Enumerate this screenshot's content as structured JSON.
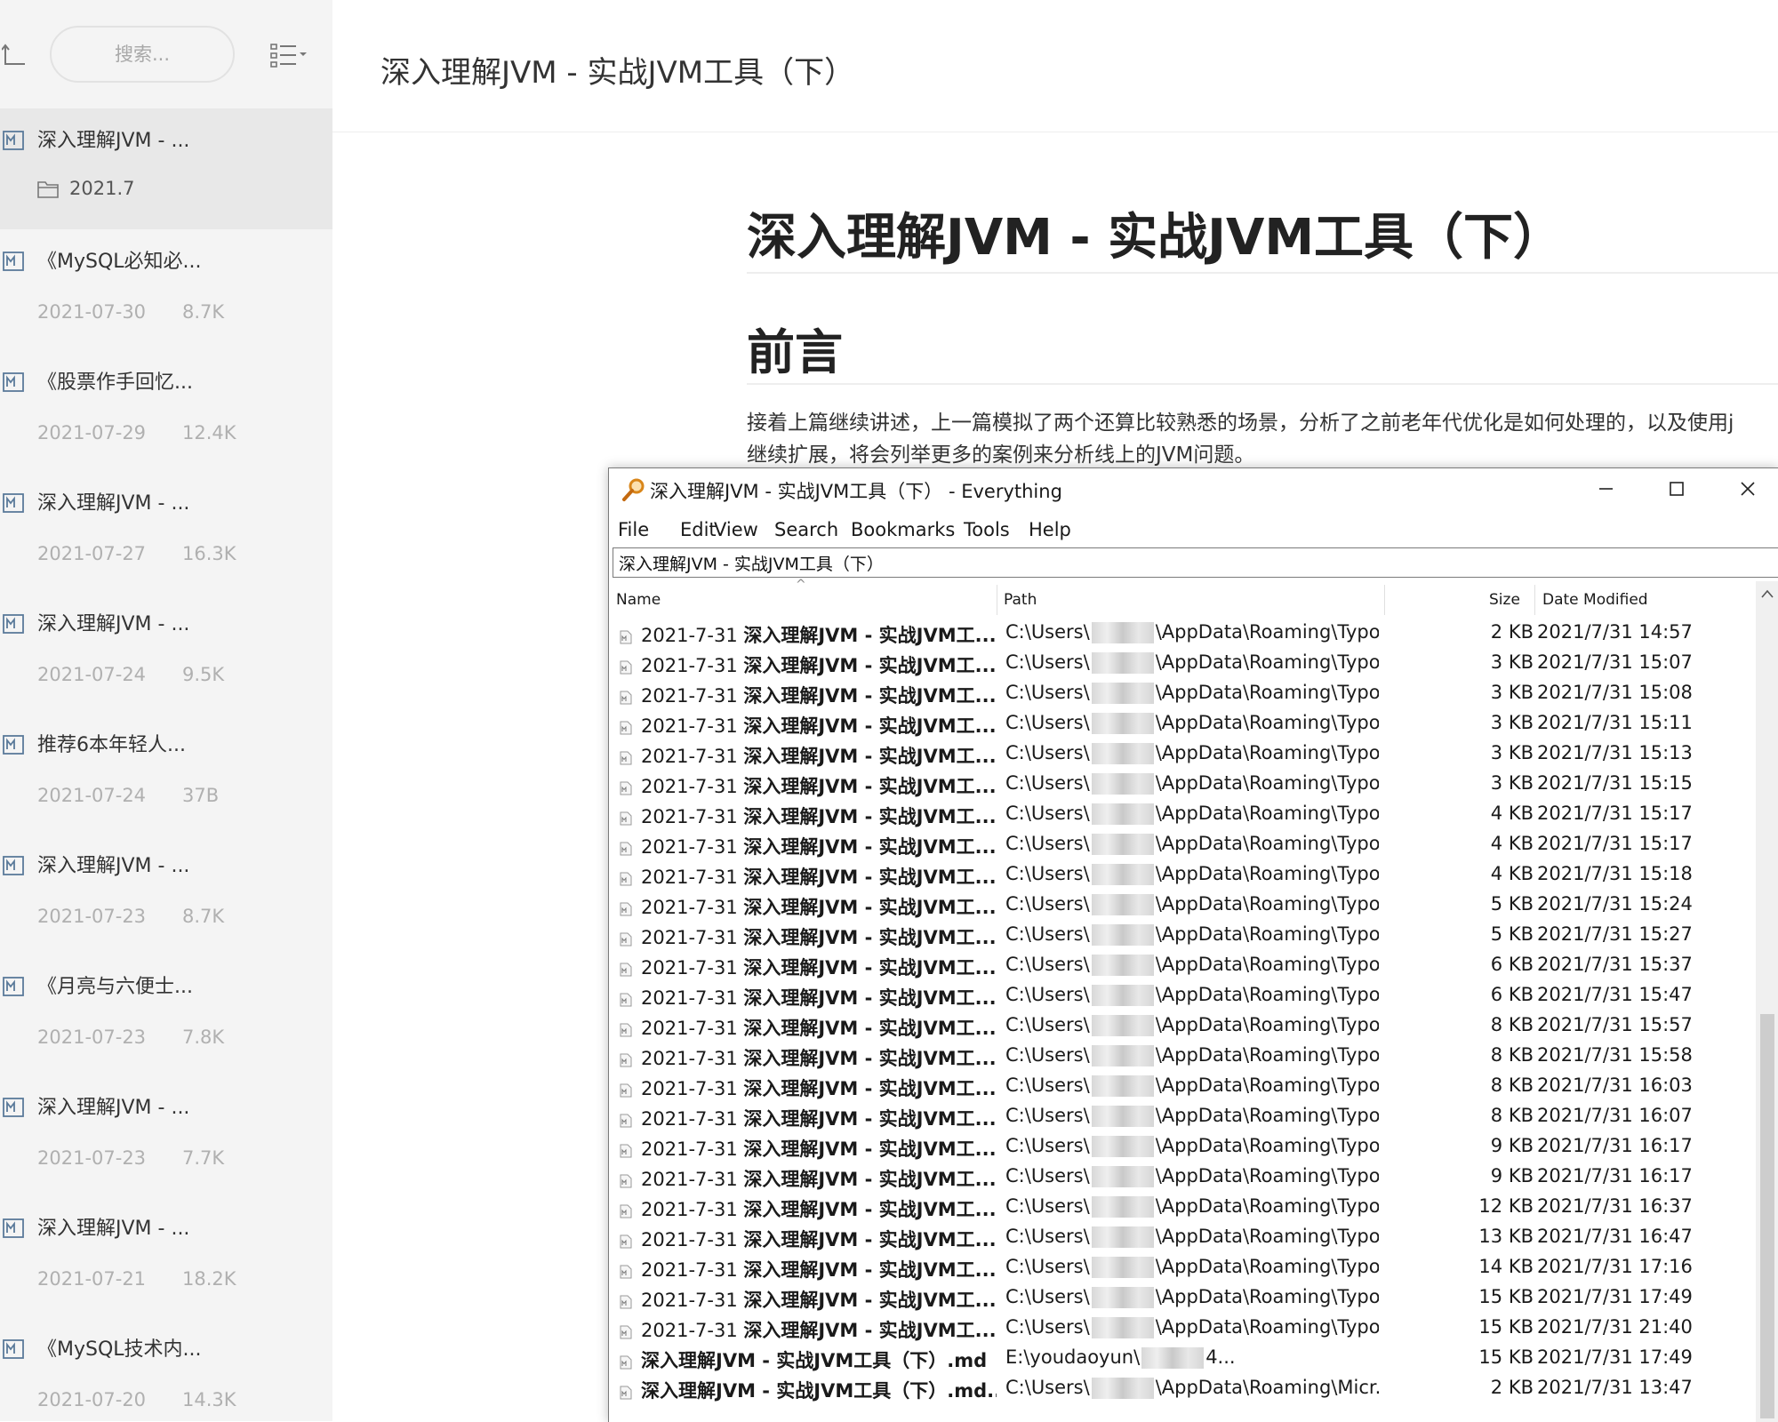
{
  "sidebar": {
    "search_placeholder": "搜索...",
    "files": [
      {
        "title": "深入理解JVM - ...",
        "folder": "2021.7",
        "active": true
      },
      {
        "title": "《MySQL必知必...",
        "date": "2021-07-30",
        "size": "8.7K"
      },
      {
        "title": "《股票作手回忆...",
        "date": "2021-07-29",
        "size": "12.4K"
      },
      {
        "title": "深入理解JVM - ...",
        "date": "2021-07-27",
        "size": "16.3K"
      },
      {
        "title": "深入理解JVM - ...",
        "date": "2021-07-24",
        "size": "9.5K"
      },
      {
        "title": "推荐6本年轻人...",
        "date": "2021-07-24",
        "size": "37B"
      },
      {
        "title": "深入理解JVM - ...",
        "date": "2021-07-23",
        "size": "8.7K"
      },
      {
        "title": "《月亮与六便士...",
        "date": "2021-07-23",
        "size": "7.8K"
      },
      {
        "title": "深入理解JVM - ...",
        "date": "2021-07-23",
        "size": "7.7K"
      },
      {
        "title": "深入理解JVM - ...",
        "date": "2021-07-21",
        "size": "18.2K"
      },
      {
        "title": "《MySQL技术内...",
        "date": "2021-07-20",
        "size": "14.3K"
      }
    ]
  },
  "editor": {
    "window_title": "深入理解JVM - 实战JVM工具（下）",
    "h1": "深入理解JVM - 实战JVM工具（下）",
    "h2": "前言",
    "paragraph_line1": " 接着上篇继续讲述，上一篇模拟了两个还算比较熟悉的场景，分析了之前老年代优化是如何处理的，以及使用j",
    "paragraph_line2": "继续扩展，将会列举更多的案例来分析线上的JVM问题。"
  },
  "everything": {
    "title": "深入理解JVM - 实战JVM工具（下） - Everything",
    "menu": [
      "File",
      "Edit",
      "View",
      "Search",
      "Bookmarks",
      "Tools",
      "Help"
    ],
    "search_value": "深入理解JVM - 实战JVM工具（下）",
    "columns": {
      "name": "Name",
      "path": "Path",
      "size": "Size",
      "date": "Date Modified"
    },
    "rows": [
      {
        "name_prefix": "2021-7-31 ",
        "name_bold": "深入理解JVM - 实战JVM工...",
        "path_prefix": "C:\\Users\\",
        "path_suffix": "\\AppData\\Roaming\\Typo...",
        "size": "2 KB",
        "date": "2021/7/31 14:57"
      },
      {
        "name_prefix": "2021-7-31 ",
        "name_bold": "深入理解JVM - 实战JVM工...",
        "path_prefix": "C:\\Users\\",
        "path_suffix": "\\AppData\\Roaming\\Typo...",
        "size": "3 KB",
        "date": "2021/7/31 15:07"
      },
      {
        "name_prefix": "2021-7-31 ",
        "name_bold": "深入理解JVM - 实战JVM工...",
        "path_prefix": "C:\\Users\\",
        "path_suffix": "\\AppData\\Roaming\\Typo...",
        "size": "3 KB",
        "date": "2021/7/31 15:08"
      },
      {
        "name_prefix": "2021-7-31 ",
        "name_bold": "深入理解JVM - 实战JVM工...",
        "path_prefix": "C:\\Users\\",
        "path_suffix": "\\AppData\\Roaming\\Typo...",
        "size": "3 KB",
        "date": "2021/7/31 15:11"
      },
      {
        "name_prefix": "2021-7-31 ",
        "name_bold": "深入理解JVM - 实战JVM工...",
        "path_prefix": "C:\\Users\\",
        "path_suffix": "\\AppData\\Roaming\\Typo...",
        "size": "3 KB",
        "date": "2021/7/31 15:13"
      },
      {
        "name_prefix": "2021-7-31 ",
        "name_bold": "深入理解JVM - 实战JVM工...",
        "path_prefix": "C:\\Users\\",
        "path_suffix": "\\AppData\\Roaming\\Typo...",
        "size": "3 KB",
        "date": "2021/7/31 15:15"
      },
      {
        "name_prefix": "2021-7-31 ",
        "name_bold": "深入理解JVM - 实战JVM工...",
        "path_prefix": "C:\\Users\\",
        "path_suffix": "\\AppData\\Roaming\\Typo...",
        "size": "4 KB",
        "date": "2021/7/31 15:17"
      },
      {
        "name_prefix": "2021-7-31 ",
        "name_bold": "深入理解JVM - 实战JVM工...",
        "path_prefix": "C:\\Users\\",
        "path_suffix": "\\AppData\\Roaming\\Typo...",
        "size": "4 KB",
        "date": "2021/7/31 15:17"
      },
      {
        "name_prefix": "2021-7-31 ",
        "name_bold": "深入理解JVM - 实战JVM工...",
        "path_prefix": "C:\\Users\\",
        "path_suffix": "\\AppData\\Roaming\\Typo...",
        "size": "4 KB",
        "date": "2021/7/31 15:18"
      },
      {
        "name_prefix": "2021-7-31 ",
        "name_bold": "深入理解JVM - 实战JVM工...",
        "path_prefix": "C:\\Users\\",
        "path_suffix": "\\AppData\\Roaming\\Typo...",
        "size": "5 KB",
        "date": "2021/7/31 15:24"
      },
      {
        "name_prefix": "2021-7-31 ",
        "name_bold": "深入理解JVM - 实战JVM工...",
        "path_prefix": "C:\\Users\\",
        "path_suffix": "\\AppData\\Roaming\\Typo...",
        "size": "5 KB",
        "date": "2021/7/31 15:27"
      },
      {
        "name_prefix": "2021-7-31 ",
        "name_bold": "深入理解JVM - 实战JVM工...",
        "path_prefix": "C:\\Users\\",
        "path_suffix": "\\AppData\\Roaming\\Typo...",
        "size": "6 KB",
        "date": "2021/7/31 15:37"
      },
      {
        "name_prefix": "2021-7-31 ",
        "name_bold": "深入理解JVM - 实战JVM工...",
        "path_prefix": "C:\\Users\\",
        "path_suffix": "\\AppData\\Roaming\\Typo...",
        "size": "6 KB",
        "date": "2021/7/31 15:47"
      },
      {
        "name_prefix": "2021-7-31 ",
        "name_bold": "深入理解JVM - 实战JVM工...",
        "path_prefix": "C:\\Users\\",
        "path_suffix": "\\AppData\\Roaming\\Typo...",
        "size": "8 KB",
        "date": "2021/7/31 15:57"
      },
      {
        "name_prefix": "2021-7-31 ",
        "name_bold": "深入理解JVM - 实战JVM工...",
        "path_prefix": "C:\\Users\\",
        "path_suffix": "\\AppData\\Roaming\\Typo...",
        "size": "8 KB",
        "date": "2021/7/31 15:58"
      },
      {
        "name_prefix": "2021-7-31 ",
        "name_bold": "深入理解JVM - 实战JVM工...",
        "path_prefix": "C:\\Users\\",
        "path_suffix": "\\AppData\\Roaming\\Typo...",
        "size": "8 KB",
        "date": "2021/7/31 16:03"
      },
      {
        "name_prefix": "2021-7-31 ",
        "name_bold": "深入理解JVM - 实战JVM工...",
        "path_prefix": "C:\\Users\\",
        "path_suffix": "\\AppData\\Roaming\\Typo...",
        "size": "8 KB",
        "date": "2021/7/31 16:07"
      },
      {
        "name_prefix": "2021-7-31 ",
        "name_bold": "深入理解JVM - 实战JVM工...",
        "path_prefix": "C:\\Users\\",
        "path_suffix": "\\AppData\\Roaming\\Typo...",
        "size": "9 KB",
        "date": "2021/7/31 16:17"
      },
      {
        "name_prefix": "2021-7-31 ",
        "name_bold": "深入理解JVM - 实战JVM工...",
        "path_prefix": "C:\\Users\\",
        "path_suffix": "\\AppData\\Roaming\\Typo...",
        "size": "9 KB",
        "date": "2021/7/31 16:17"
      },
      {
        "name_prefix": "2021-7-31 ",
        "name_bold": "深入理解JVM - 实战JVM工...",
        "path_prefix": "C:\\Users\\",
        "path_suffix": "\\AppData\\Roaming\\Typo...",
        "size": "12 KB",
        "date": "2021/7/31 16:37"
      },
      {
        "name_prefix": "2021-7-31 ",
        "name_bold": "深入理解JVM - 实战JVM工...",
        "path_prefix": "C:\\Users\\",
        "path_suffix": "\\AppData\\Roaming\\Typo...",
        "size": "13 KB",
        "date": "2021/7/31 16:47"
      },
      {
        "name_prefix": "2021-7-31 ",
        "name_bold": "深入理解JVM - 实战JVM工...",
        "path_prefix": "C:\\Users\\",
        "path_suffix": "\\AppData\\Roaming\\Typo...",
        "size": "14 KB",
        "date": "2021/7/31 17:16"
      },
      {
        "name_prefix": "2021-7-31 ",
        "name_bold": "深入理解JVM - 实战JVM工...",
        "path_prefix": "C:\\Users\\",
        "path_suffix": "\\AppData\\Roaming\\Typo...",
        "size": "15 KB",
        "date": "2021/7/31 17:49"
      },
      {
        "name_prefix": "2021-7-31 ",
        "name_bold": "深入理解JVM - 实战JVM工...",
        "path_prefix": "C:\\Users\\",
        "path_suffix": "\\AppData\\Roaming\\Typo...",
        "size": "15 KB",
        "date": "2021/7/31 21:40"
      },
      {
        "name_prefix": "",
        "name_bold": "深入理解JVM - 实战JVM工具（下）.md",
        "path_prefix": "E:\\youdaoyun\\",
        "path_suffix": "4...",
        "size": "15 KB",
        "date": "2021/7/31 17:49"
      },
      {
        "name_prefix": "",
        "name_bold": "深入理解JVM - 实战JVM工具（下）.md....",
        "path_prefix": "C:\\Users\\",
        "path_suffix": "\\AppData\\Roaming\\Micr...",
        "size": "2 KB",
        "date": "2021/7/31 13:47"
      }
    ]
  }
}
